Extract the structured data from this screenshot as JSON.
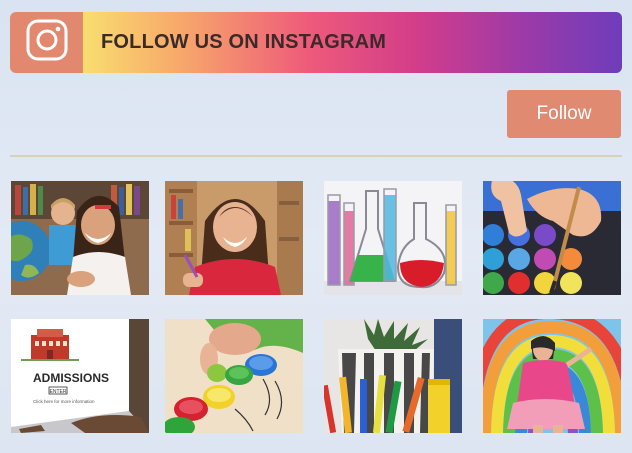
{
  "banner": {
    "title": "FOLLOW US ON INSTAGRAM",
    "icon": "instagram-icon",
    "icon_bg_color": "#e2886f",
    "gradient_colors": [
      "#f9de70",
      "#ee5a7a",
      "#d23d8a",
      "#6e3dbb"
    ]
  },
  "follow_button": {
    "label": "Follow",
    "color": "#e08a72"
  },
  "gallery": {
    "photos": [
      {
        "subject": "girl-with-globe-photo"
      },
      {
        "subject": "girl-drawing-photo"
      },
      {
        "subject": "lab-flasks-photo"
      },
      {
        "subject": "paint-palette-photo"
      },
      {
        "subject": "admissions-laptop-photo",
        "screen_title": "ADMISSIONS",
        "screen_button": "ENTER",
        "screen_caption": "Click here for more information"
      },
      {
        "subject": "bottle-caps-photo"
      },
      {
        "subject": "pencil-pot-photo"
      },
      {
        "subject": "rainbow-painting-photo"
      }
    ]
  }
}
